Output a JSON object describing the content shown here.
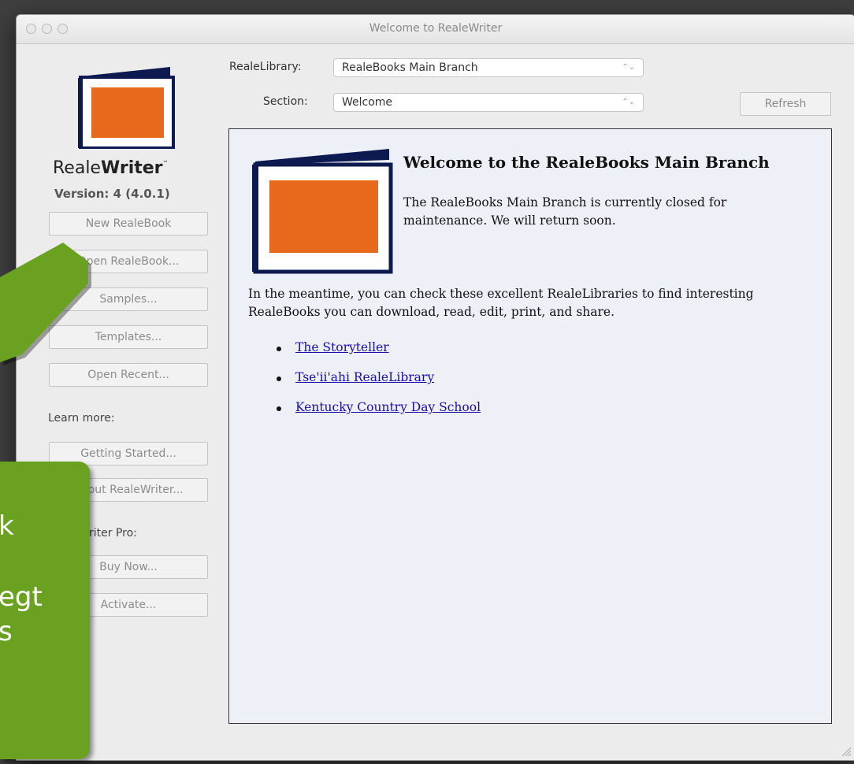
{
  "window": {
    "title": "Welcome to RealeWriter"
  },
  "sidebar": {
    "brand_light": "Reale",
    "brand_bold": "Writer",
    "brand_tm": "™",
    "version": "Version: 4 (4.0.1)",
    "buttons": {
      "new": "New RealeBook",
      "open": "Open RealeBook...",
      "samples": "Samples...",
      "templates": "Templates...",
      "recent": "Open Recent...",
      "getting_started": "Getting Started...",
      "about": "About RealeWriter...",
      "buy": "Buy Now...",
      "activate": "Activate..."
    },
    "learn_more": "Learn more:",
    "pro_label": "RealeWriter Pro:"
  },
  "toolbar": {
    "library_label": "RealeLibrary:",
    "library_value": "RealeBooks Main Branch",
    "section_label": "Section:",
    "section_value": "Welcome",
    "refresh": "Refresh"
  },
  "content": {
    "heading": "Welcome to the RealeBooks Main Branch",
    "closed": "The RealeBooks Main Branch is currently closed for maintenance. We will return soon.",
    "meantime": "In the meantime, you can check these excellent RealeLibraries to find interesting RealeBooks you can download, read, edit, print, and share.",
    "links": [
      "The Storyteller",
      "Tse'ii'ahi RealeLibrary",
      "Kentucky Country Day School"
    ]
  },
  "overlay": {
    "callout_lines": [
      "k",
      "egt",
      "s"
    ],
    "accent": "#6aa121"
  }
}
